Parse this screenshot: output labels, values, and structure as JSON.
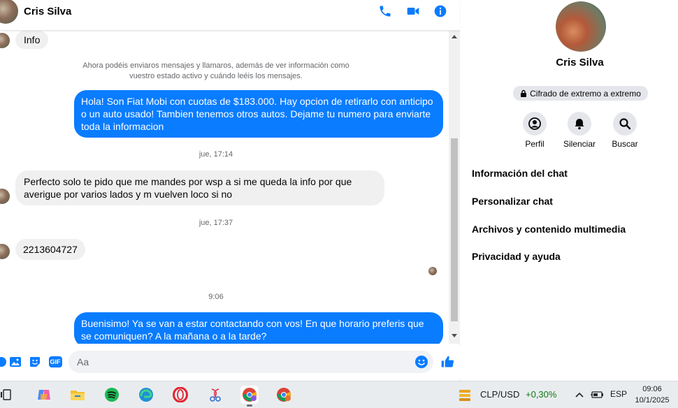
{
  "header": {
    "name": "Cris Silva",
    "call_icon": "phone-icon",
    "video_icon": "video-camera-icon",
    "info_icon": "info-icon"
  },
  "messages": {
    "info_bubble": "Info",
    "system_notice": "Ahora podéis enviaros mensajes y llamaros, además de ver información como vuestro estado activo y cuándo leéis los mensajes.",
    "out_1": "Hola! Son Fiat Mobi con cuotas de $183.000. Hay opcion de retirarlo con anticipo o un auto usado! Tambien tenemos otros autos. Dejame tu numero para enviarte toda la informacion",
    "time_1": "jue, 17:14",
    "in_1": "Perfecto solo te pido que me mandes por wsp a si me queda la info por que averigue por varios lados y m vuelven loco si no",
    "time_2": "jue, 17:37",
    "in_2": "2213604727",
    "time_3": "9:06",
    "out_2": "Buenisimo! Ya se van a estar contactando con vos! En que horario preferis que se comuniquen? A la mañana o a la tarde?"
  },
  "composer": {
    "placeholder": "Aa",
    "gif_label": "GIF"
  },
  "panel": {
    "name": "Cris Silva",
    "e2e_label": "Cifrado de extremo a extremo",
    "actions": [
      {
        "label": "Perfil",
        "icon": "profile-icon"
      },
      {
        "label": "Silenciar",
        "icon": "bell-icon"
      },
      {
        "label": "Buscar",
        "icon": "search-icon"
      }
    ],
    "menu": [
      "Información del chat",
      "Personalizar chat",
      "Archivos y contenido multimedia",
      "Privacidad y ayuda"
    ]
  },
  "taskbar": {
    "currency": "CLP/USD",
    "change": "+0,30%",
    "lang": "ESP",
    "time": "09:06",
    "date": "10/1/2025"
  },
  "colors": {
    "accent": "#0a7cff",
    "incoming_bubble": "#f0f0f0",
    "positive": "#0f7b0f"
  }
}
